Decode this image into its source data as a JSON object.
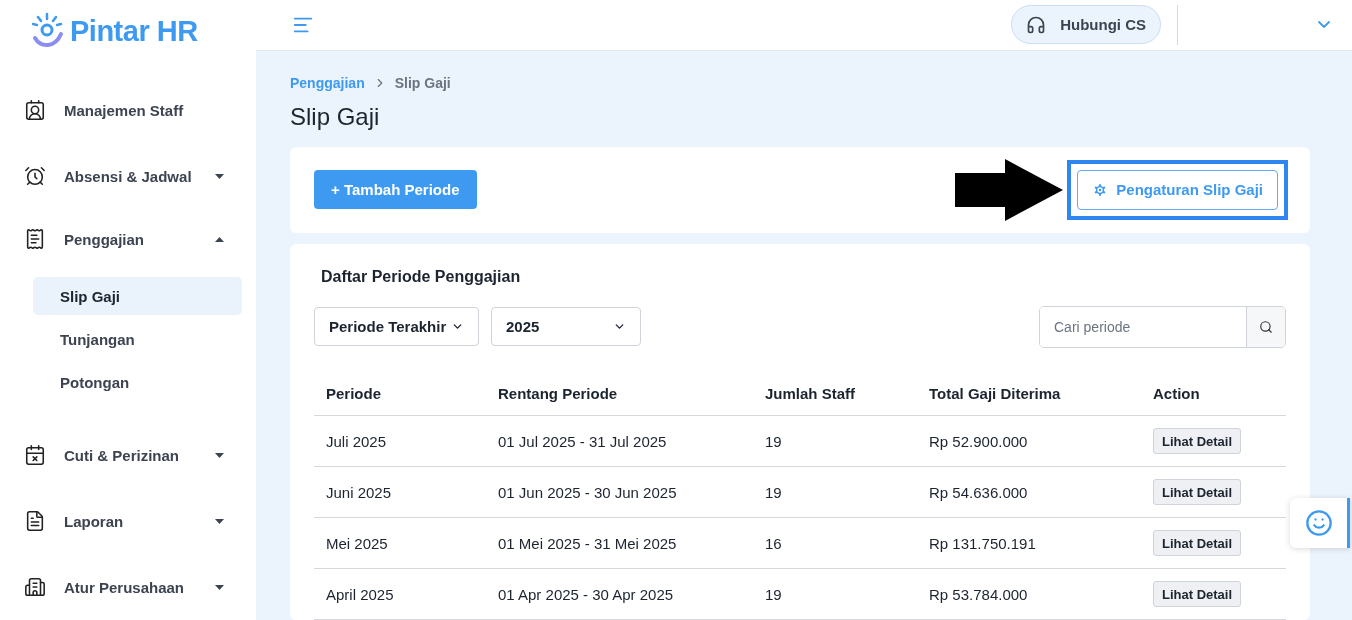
{
  "logo": {
    "text": "Pintar HR"
  },
  "sidebar": {
    "items": [
      {
        "label": "Manajemen Staff",
        "kind": "link"
      },
      {
        "label": "Absensi & Jadwal",
        "kind": "group",
        "expanded": false
      },
      {
        "label": "Penggajian",
        "kind": "group",
        "expanded": true,
        "children": [
          {
            "label": "Slip Gaji",
            "selected": true
          },
          {
            "label": "Tunjangan",
            "selected": false
          },
          {
            "label": "Potongan",
            "selected": false
          }
        ]
      },
      {
        "label": "Cuti & Perizinan",
        "kind": "group",
        "expanded": false
      },
      {
        "label": "Laporan",
        "kind": "group",
        "expanded": false
      },
      {
        "label": "Atur Perusahaan",
        "kind": "group",
        "expanded": false
      }
    ]
  },
  "header": {
    "contact_button": "Hubungi CS"
  },
  "breadcrumb": [
    "Penggajian",
    "Slip Gaji"
  ],
  "page_title": "Slip Gaji",
  "toolbar": {
    "add_button": "+ Tambah Periode",
    "settings_button": {
      "label": "Pengaturan Slip Gaji",
      "highlighted": true
    }
  },
  "list": {
    "title": "Daftar Periode Penggajian",
    "filters": [
      {
        "value": "Periode Terakhir"
      },
      {
        "value": "2025"
      }
    ],
    "search": {
      "placeholder": "Cari periode"
    },
    "table": {
      "columns": [
        "Periode",
        "Rentang Periode",
        "Jumlah Staff",
        "Total Gaji Diterima",
        "Action"
      ],
      "rows": [
        {
          "periode": "Juli 2025",
          "range": "01 Jul 2025 - 31 Jul 2025",
          "staff": "19",
          "total": "Rp 52.900.000",
          "action": "Lihat Detail"
        },
        {
          "periode": "Juni 2025",
          "range": "01 Jun 2025 - 30 Jun 2025",
          "staff": "19",
          "total": "Rp 54.636.000",
          "action": "Lihat Detail"
        },
        {
          "periode": "Mei 2025",
          "range": "01 Mei 2025 - 31 Mei 2025",
          "staff": "16",
          "total": "Rp 131.750.191",
          "action": "Lihat Detail"
        },
        {
          "periode": "April 2025",
          "range": "01 Apr 2025 - 30 Apr 2025",
          "staff": "19",
          "total": "Rp 53.784.000",
          "action": "Lihat Detail"
        }
      ]
    }
  }
}
